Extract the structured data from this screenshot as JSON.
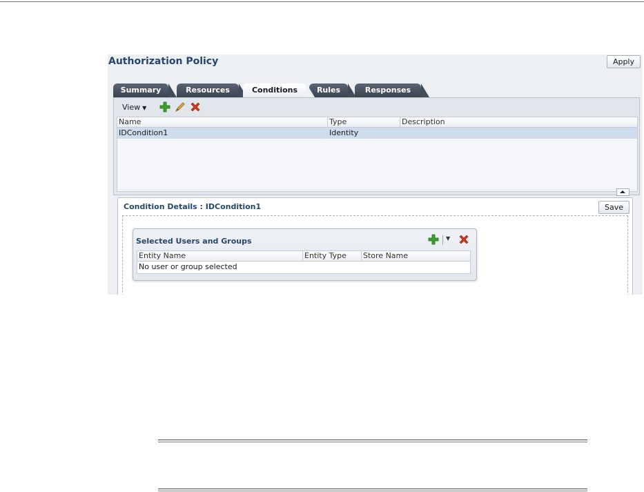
{
  "policy": {
    "title": "Authorization Policy",
    "apply_label": "Apply"
  },
  "tabs": [
    {
      "label": "Summary"
    },
    {
      "label": "Resources"
    },
    {
      "label": "Conditions"
    },
    {
      "label": "Rules"
    },
    {
      "label": "Responses"
    }
  ],
  "active_tab": "Conditions",
  "toolbar": {
    "view_label": "View",
    "icons": [
      "add-icon",
      "edit-icon",
      "delete-icon"
    ]
  },
  "conditions_table": {
    "columns": [
      "Name",
      "Type",
      "Description"
    ],
    "rows": [
      {
        "name": "IDCondition1",
        "type": "Identity",
        "description": ""
      }
    ]
  },
  "details": {
    "title": "Condition Details : IDCondition1",
    "save_label": "Save"
  },
  "users_groups": {
    "title": "Selected Users and Groups",
    "columns": [
      "Entity Name",
      "Entity Type",
      "Store Name"
    ],
    "empty_message": "No user or group selected"
  },
  "colors": {
    "title_blue": "#24466f",
    "tab_dark": "#3a4350",
    "selected_row": "#cfdcee",
    "add_green": "#3aa12a",
    "delete_red": "#d23a1e"
  }
}
